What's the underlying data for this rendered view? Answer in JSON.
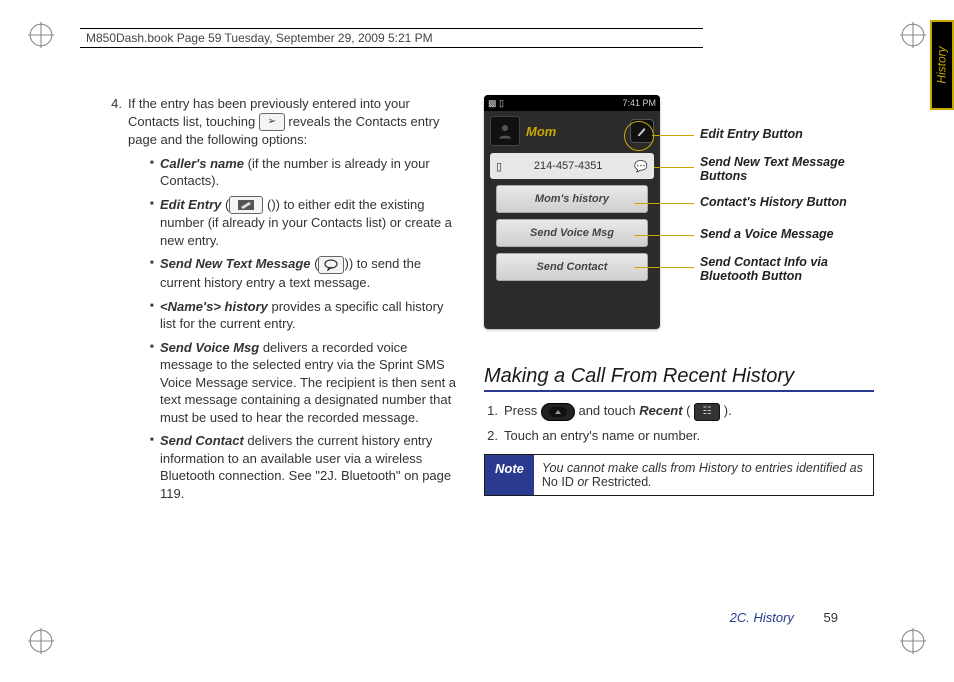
{
  "header": "M850Dash.book  Page 59  Tuesday, September 29, 2009  5:21 PM",
  "side_tab": "History",
  "left": {
    "num4": "4.",
    "intro_a": "If the entry has been previously entered into your Contacts list, touching ",
    "intro_b": " reveals the Contacts entry page and the following options:",
    "b1_em": "Caller's name",
    "b1_rest": " (if the number is already in your Contacts).",
    "b2_em": "Edit Entry",
    "b2_mid": " (",
    "b2_rest": ") to either edit the existing number (if already in your Contacts list) or create a new entry.",
    "b3_em": "Send New Text Message",
    "b3_mid": " (",
    "b3_rest": ") to send the current history entry a text message.",
    "b4_em": "<Name's> history",
    "b4_rest": " provides a specific call history list for the current entry.",
    "b5_em": "Send Voice Msg",
    "b5_rest": " delivers a recorded voice message to the selected entry via the Sprint SMS Voice Message service. The recipient is then sent a text message containing a designated number that must be used to hear the recorded message.",
    "b6_em": "Send Contact",
    "b6_rest": " delivers the current history entry information to an available user via a wireless Bluetooth connection. See \"2J. Bluetooth\" on page 119."
  },
  "phone": {
    "time": "7:41 PM",
    "title": "Mom",
    "number": "214-457-4351",
    "items": [
      "Mom's history",
      "Send Voice Msg",
      "Send Contact"
    ]
  },
  "callouts": {
    "c1": "Edit Entry Button",
    "c2": "Send New Text Message Buttons",
    "c3": "Contact's History Button",
    "c4": "Send a Voice Message",
    "c5": "Send Contact Info via Bluetooth Button"
  },
  "section_title": "Making a Call From Recent History",
  "steps": {
    "s1n": "1.",
    "s1a": "Press ",
    "s1b": " and touch ",
    "s1_em": "Recent",
    "s1c": " (",
    "s1d": ").",
    "s2n": "2.",
    "s2": "Touch an entry's name or number."
  },
  "note": {
    "label": "Note",
    "a": "You cannot make calls from History to entries identified as ",
    "b": "No ID",
    "c": " or ",
    "d": "Restricted",
    "e": "."
  },
  "footer_section": "2C. History",
  "footer_page": "59"
}
